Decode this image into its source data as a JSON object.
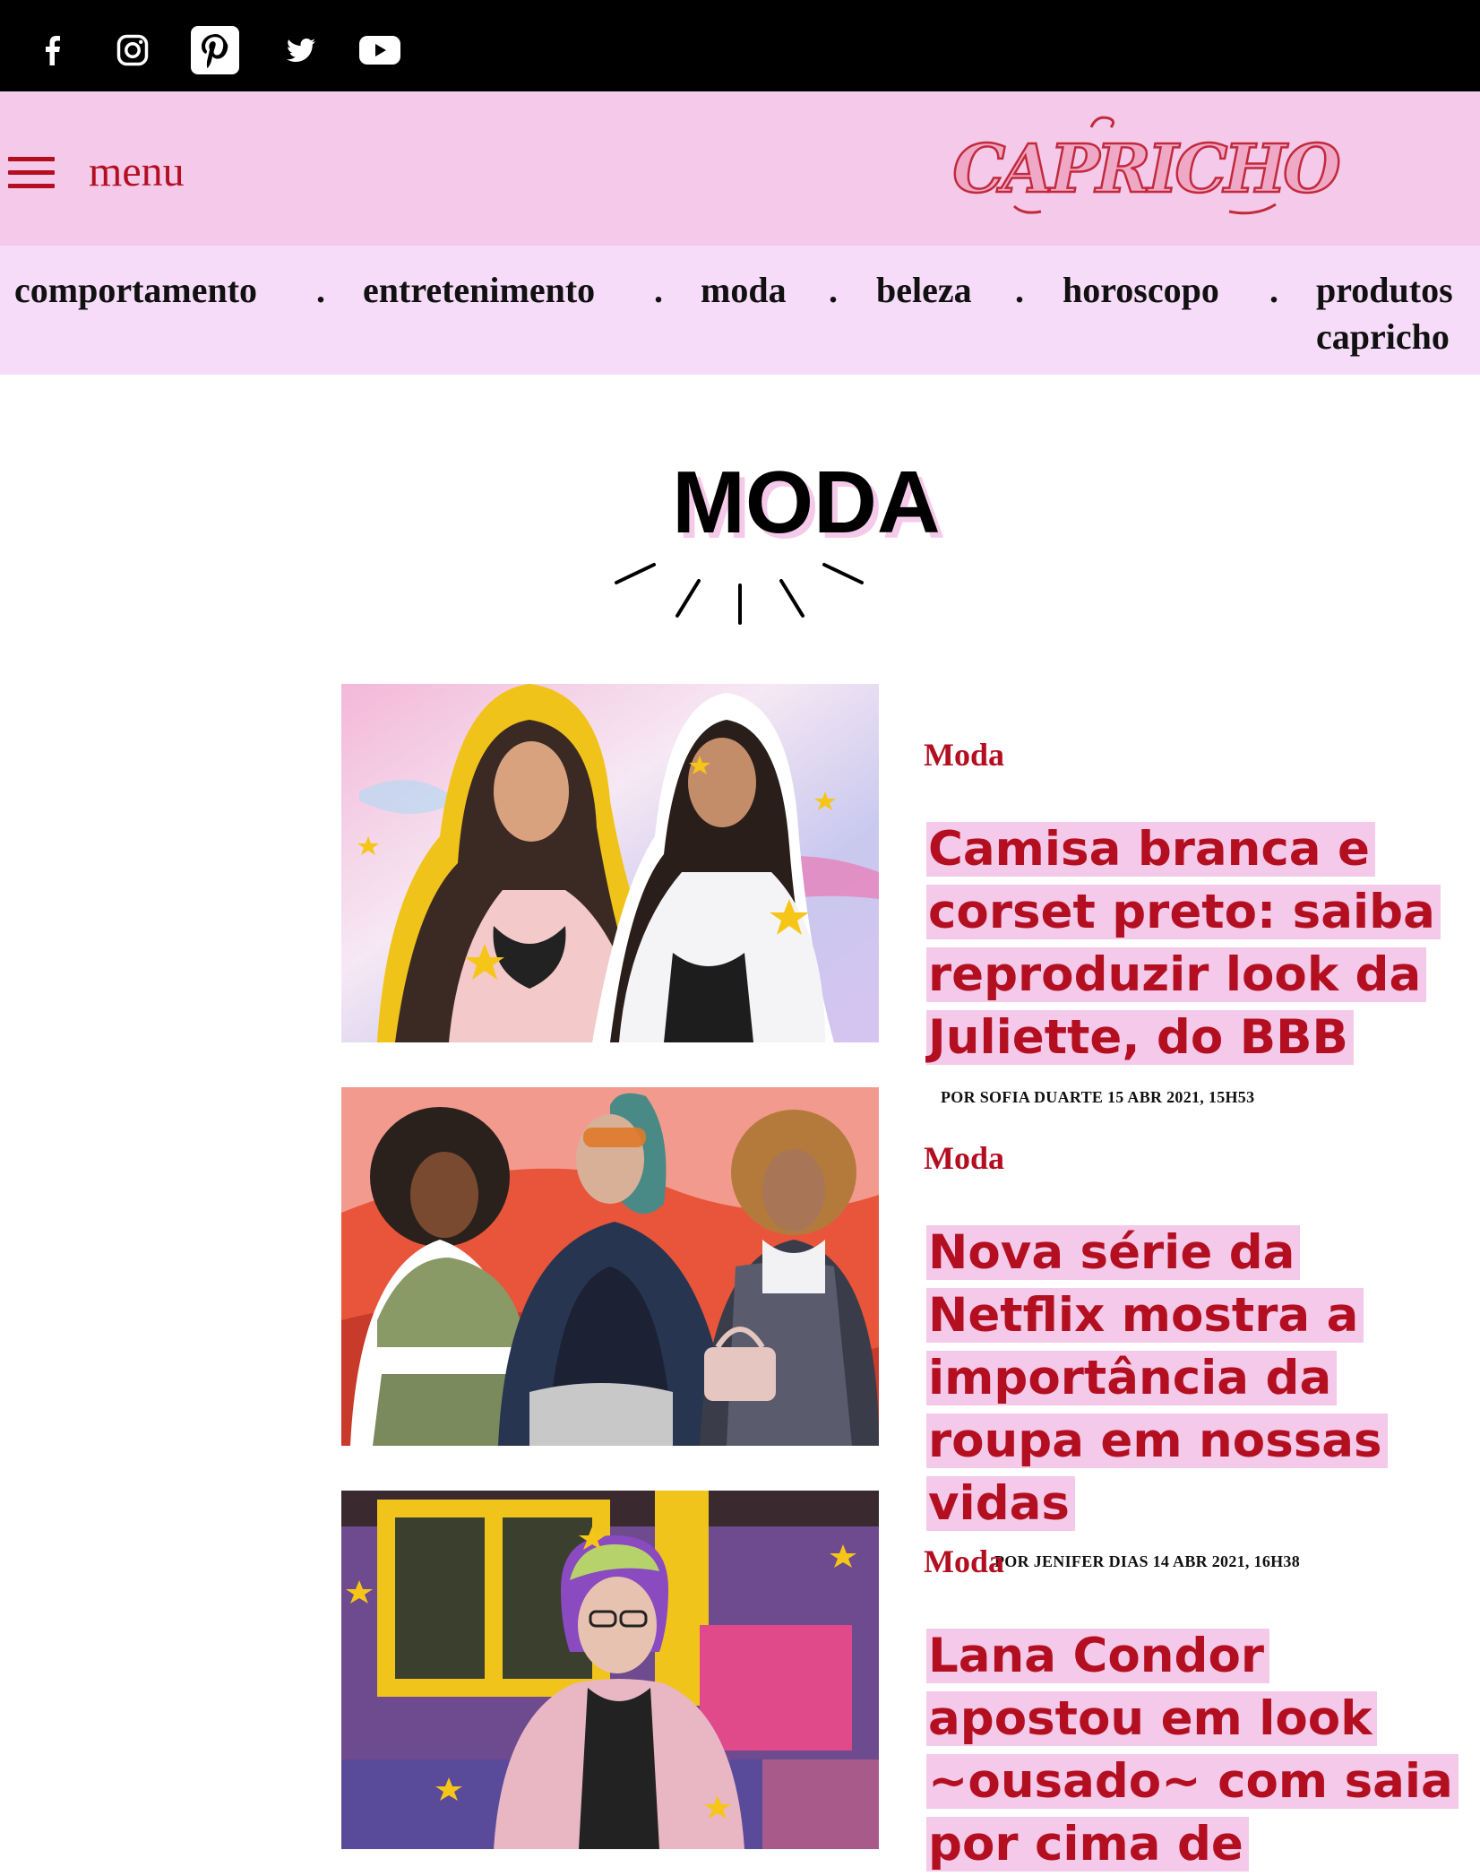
{
  "social": {
    "items": [
      {
        "name": "facebook-icon"
      },
      {
        "name": "instagram-icon"
      },
      {
        "name": "pinterest-icon"
      },
      {
        "name": "twitter-icon"
      },
      {
        "name": "youtube-icon"
      }
    ]
  },
  "header": {
    "menu_label": "menu",
    "logo_text": "CAPRICHO",
    "bg_color": "#f4c9e9",
    "accent_color": "#b30f21"
  },
  "catnav": {
    "items": [
      "comportamento",
      "entretenimento",
      "moda",
      "beleza",
      "horoscopo",
      "produtos capricho"
    ],
    "separator": ".",
    "products_line1": "produtos",
    "products_line2": "capricho"
  },
  "page": {
    "title": "MODA"
  },
  "articles": [
    {
      "category": "Moda",
      "title": "Camisa branca e corset preto: saiba reproduzir look da Juliette, do BBB",
      "byline": "POR SOFIA DUARTE 15 ABR 2021, 15H53"
    },
    {
      "category": "Moda",
      "title": "Nova série da Netflix mostra a importância da roupa em nossas vidas",
      "byline": "POR JENIFER DIAS 14 ABR 2021, 16H38"
    },
    {
      "category": "Moda",
      "title": "Lana Condor apostou em look ~ousado~ com saia por cima de",
      "byline": ""
    }
  ]
}
